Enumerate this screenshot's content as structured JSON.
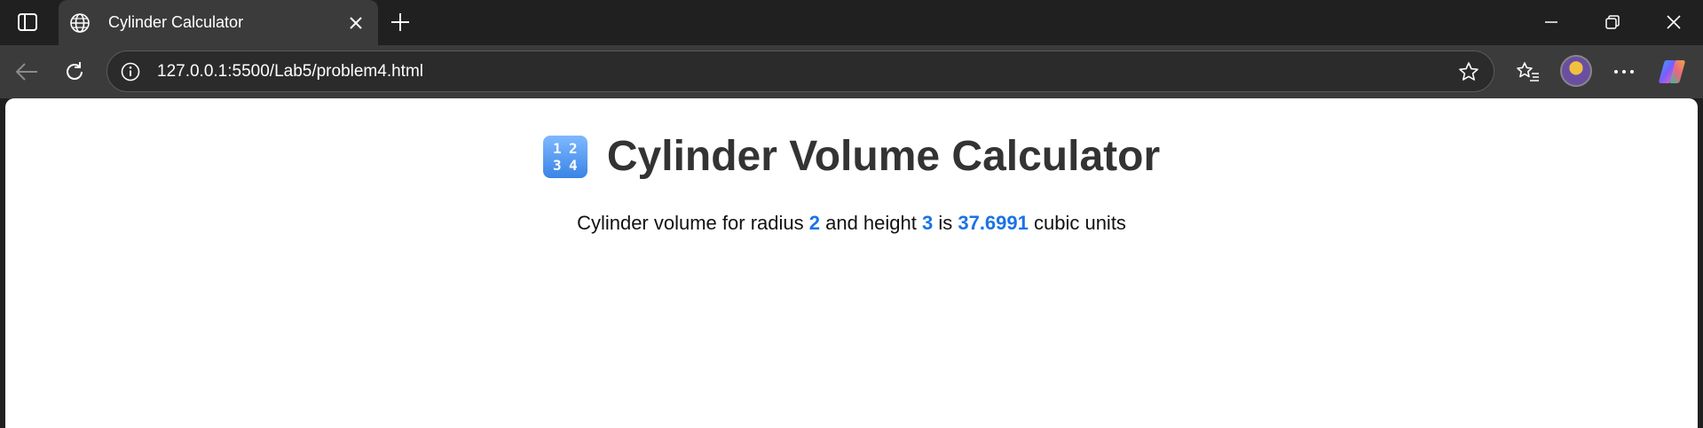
{
  "browser": {
    "tab": {
      "title": "Cylinder Calculator"
    },
    "address_bar": {
      "url": "127.0.0.1:5500/Lab5/problem4.html"
    }
  },
  "page": {
    "heading_emoji": [
      "1",
      "2",
      "3",
      "4"
    ],
    "title": "Cylinder Volume Calculator",
    "result": {
      "prefix": "Cylinder volume for radius ",
      "radius": "2",
      "middle": " and height ",
      "height": "3",
      "is_text": " is ",
      "volume": "37.6991",
      "suffix": " cubic units"
    }
  },
  "colors": {
    "accent": "#1a73e8",
    "heading": "#333333",
    "chrome_dark": "#202020",
    "chrome_toolbar": "#3b3b3b"
  }
}
